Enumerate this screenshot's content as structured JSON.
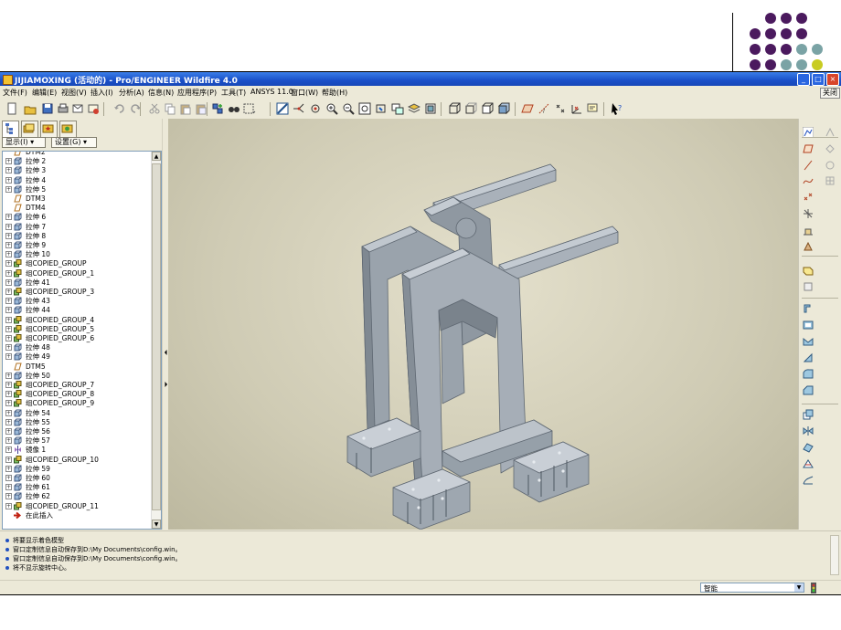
{
  "slide": {
    "accent_colors": [
      "#4b1a5e",
      "#7aa3a5",
      "#c8cc22"
    ]
  },
  "window": {
    "title": "JIJIAMOXING (活动的) - Pro/ENGINEER Wildfire 4.0",
    "buttons": [
      "_",
      "□",
      "×"
    ]
  },
  "menu": {
    "items": [
      "文件(F)",
      "编辑(E)",
      "视图(V)",
      "插入(I)",
      "分析(A)",
      "信息(N)",
      "应用程序(P)",
      "工具(T)",
      "ANSYS 11.0",
      "窗口(W)",
      "帮助(H)"
    ],
    "close_label": "关闭"
  },
  "left_panel": {
    "show_label": "显示(I) ▾",
    "settings_label": "设置(G) ▾",
    "tree_items": [
      {
        "label": "DTM2",
        "type": "datum"
      },
      {
        "label": "拉伸 2",
        "type": "extrude"
      },
      {
        "label": "拉伸 3",
        "type": "extrude"
      },
      {
        "label": "拉伸 4",
        "type": "extrude"
      },
      {
        "label": "拉伸 5",
        "type": "extrude"
      },
      {
        "label": "DTM3",
        "type": "datum"
      },
      {
        "label": "DTM4",
        "type": "datum"
      },
      {
        "label": "拉伸 6",
        "type": "extrude"
      },
      {
        "label": "拉伸 7",
        "type": "extrude"
      },
      {
        "label": "拉伸 8",
        "type": "extrude"
      },
      {
        "label": "拉伸 9",
        "type": "extrude"
      },
      {
        "label": "拉伸 10",
        "type": "extrude"
      },
      {
        "label": "组COPIED_GROUP",
        "type": "group"
      },
      {
        "label": "组COPIED_GROUP_1",
        "type": "group"
      },
      {
        "label": "拉伸 41",
        "type": "extrude"
      },
      {
        "label": "组COPIED_GROUP_3",
        "type": "group"
      },
      {
        "label": "拉伸 43",
        "type": "extrude"
      },
      {
        "label": "拉伸 44",
        "type": "extrude"
      },
      {
        "label": "组COPIED_GROUP_4",
        "type": "group"
      },
      {
        "label": "组COPIED_GROUP_5",
        "type": "group"
      },
      {
        "label": "组COPIED_GROUP_6",
        "type": "group"
      },
      {
        "label": "拉伸 48",
        "type": "extrude"
      },
      {
        "label": "拉伸 49",
        "type": "extrude"
      },
      {
        "label": "DTM5",
        "type": "datum"
      },
      {
        "label": "拉伸 50",
        "type": "extrude"
      },
      {
        "label": "组COPIED_GROUP_7",
        "type": "group"
      },
      {
        "label": "组COPIED_GROUP_8",
        "type": "group"
      },
      {
        "label": "组COPIED_GROUP_9",
        "type": "group"
      },
      {
        "label": "拉伸 54",
        "type": "extrude"
      },
      {
        "label": "拉伸 55",
        "type": "extrude"
      },
      {
        "label": "拉伸 56",
        "type": "extrude"
      },
      {
        "label": "拉伸 57",
        "type": "extrude"
      },
      {
        "label": "镜像 1",
        "type": "mirror"
      },
      {
        "label": "组COPIED_GROUP_10",
        "type": "group"
      },
      {
        "label": "拉伸 59",
        "type": "extrude"
      },
      {
        "label": "拉伸 60",
        "type": "extrude"
      },
      {
        "label": "拉伸 61",
        "type": "extrude"
      },
      {
        "label": "拉伸 62",
        "type": "extrude"
      },
      {
        "label": "组COPIED_GROUP_11",
        "type": "group"
      },
      {
        "label": "在此插入",
        "type": "insert"
      }
    ]
  },
  "messages": [
    "将要显示着色模型",
    "窗口定制信息自动保存到D:\\My Documents\\config.win。",
    "窗口定制信息自动保存到D:\\My Documents\\config.win。",
    "将不显示旋转中心。"
  ],
  "status": {
    "filter_value": "智能"
  }
}
